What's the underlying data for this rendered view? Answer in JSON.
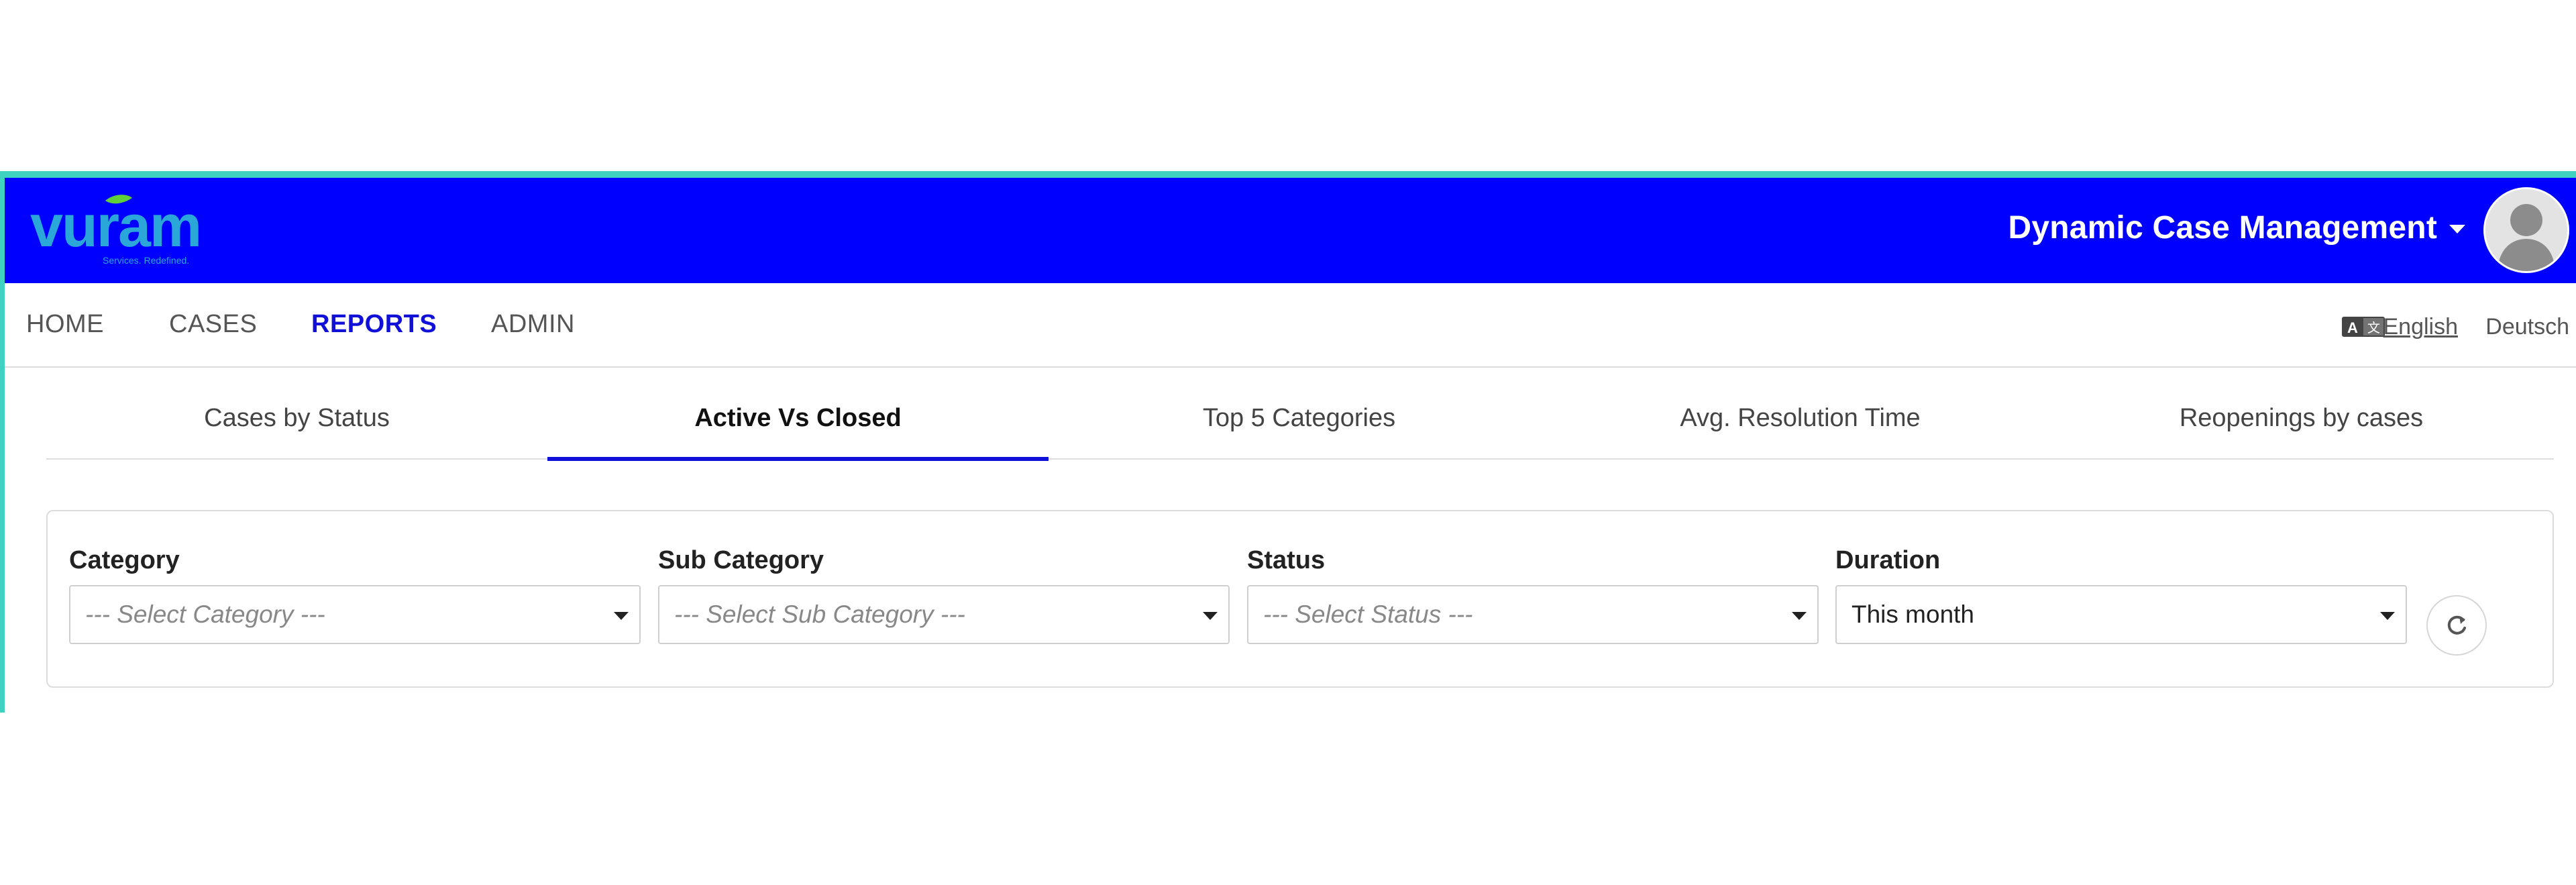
{
  "header": {
    "logo_text": "vuram",
    "logo_tagline": "Services. Redefined.",
    "app_title": "Dynamic Case Management",
    "bg_color": "#0000ff",
    "frame_color": "#3fd2c0"
  },
  "nav": {
    "items": [
      {
        "label": "HOME",
        "active": false
      },
      {
        "label": "CASES",
        "active": false
      },
      {
        "label": "REPORTS",
        "active": true
      },
      {
        "label": "ADMIN",
        "active": false
      }
    ],
    "active_color": "#1010d8"
  },
  "language": {
    "icon": "translate-icon",
    "options": [
      "English",
      "Deutsch"
    ],
    "selected": "English"
  },
  "tabs": {
    "items": [
      {
        "label": "Cases by Status",
        "active": false
      },
      {
        "label": "Active Vs Closed",
        "active": true
      },
      {
        "label": "Top 5 Categories",
        "active": false
      },
      {
        "label": "Avg. Resolution Time",
        "active": false
      },
      {
        "label": "Reopenings by cases",
        "active": false
      }
    ]
  },
  "filters": {
    "category": {
      "label": "Category",
      "placeholder": "--- Select Category ---",
      "value": ""
    },
    "sub_category": {
      "label": "Sub Category",
      "placeholder": "--- Select Sub Category ---",
      "value": ""
    },
    "status": {
      "label": "Status",
      "placeholder": "--- Select Status ---",
      "value": ""
    },
    "duration": {
      "label": "Duration",
      "placeholder": "",
      "value": "This month"
    },
    "refresh_icon": "refresh-icon"
  }
}
